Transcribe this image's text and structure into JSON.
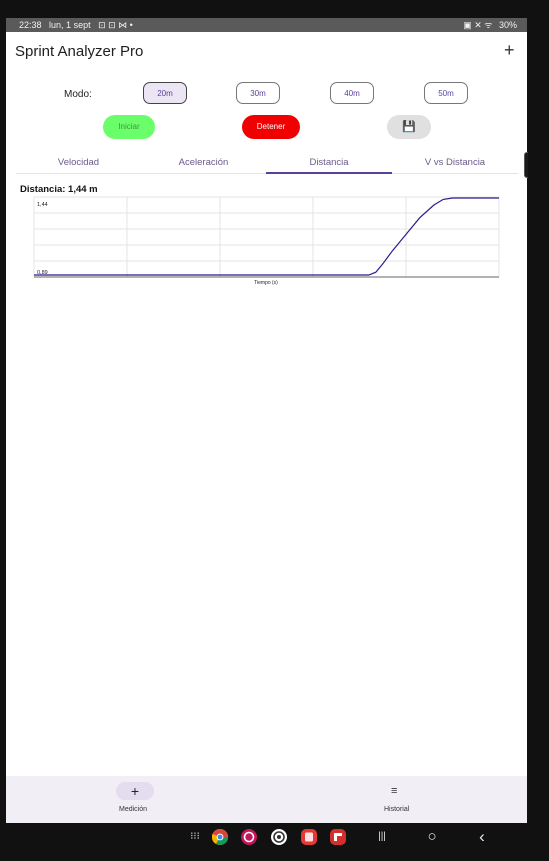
{
  "status_bar": {
    "time": "22:38",
    "date": "lun, 1 sept",
    "left_icons": "⊡ ⊡ ⋈ •",
    "right_icons": "▣ ✕ ᯤ",
    "battery": "30%"
  },
  "app": {
    "title": "Sprint Analyzer Pro",
    "add_icon": "+"
  },
  "mode": {
    "label": "Modo:",
    "options": [
      "20m",
      "30m",
      "40m",
      "50m"
    ],
    "selected": "20m"
  },
  "actions": {
    "start_label": "Iniciar",
    "stop_label": "Detener",
    "save_icon": "💾"
  },
  "tabs": {
    "items": [
      "Velocidad",
      "Aceleración",
      "Distancia",
      "V vs Distancia"
    ],
    "active": "Distancia"
  },
  "chart_title": "Distancia: 1,44 m",
  "chart_data": {
    "type": "line",
    "title": "Distancia: 1,44 m",
    "xlabel": "Tiempo (s)",
    "ylabel": "",
    "y_tick_labels": [
      "1,44",
      "0,89"
    ],
    "ylim": [
      0.89,
      1.44
    ],
    "grid": true,
    "series": [
      {
        "color": "#2a1a8f",
        "points": [
          [
            0.0,
            0.89
          ],
          [
            0.72,
            0.89
          ],
          [
            0.735,
            0.91
          ],
          [
            0.75,
            0.97
          ],
          [
            0.77,
            1.06
          ],
          [
            0.8,
            1.18
          ],
          [
            0.83,
            1.3
          ],
          [
            0.86,
            1.39
          ],
          [
            0.88,
            1.43
          ],
          [
            0.9,
            1.44
          ],
          [
            1.0,
            1.44
          ]
        ]
      }
    ]
  },
  "bottom_nav": {
    "medicion_icon": "+",
    "medicion_label": "Medición",
    "historial_icon": "≡",
    "historial_label": "Historial"
  },
  "system_nav": {
    "apps_icon": "⁝⁝⁝",
    "recents_icon": "|||",
    "home_icon": "○",
    "back_icon": "‹"
  }
}
